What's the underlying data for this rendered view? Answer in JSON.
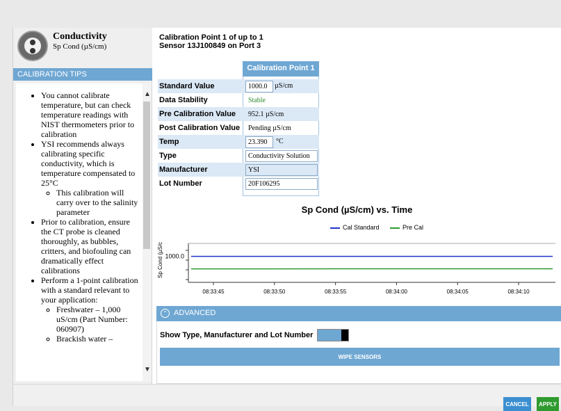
{
  "sensor": {
    "name": "Conductivity",
    "subtitle": "Sp Cond (µS/cm)",
    "icon": "conductivity-sensor-icon"
  },
  "tips": {
    "header": "CALIBRATION TIPS",
    "items": [
      "You cannot calibrate temperature, but can check temperature readings with NIST thermometers prior to calibration",
      "YSI recommends always calibrating specific conductivity, which is temperature compensated to 25°C",
      "This calibration will carry over to the salinity parameter",
      "Prior to calibration, ensure the CT probe is cleaned thoroughly, as bubbles, critters, and biofouling can dramatically effect calibrations",
      "Perform a 1-point calibration with a standard relevant to your application:",
      "Freshwater – 1,000 uS/cm (Part Number: 060907)",
      "Brackish water –"
    ]
  },
  "calibration": {
    "title_line1": "Calibration Point  1  of up to  1",
    "title_line2": "Sensor 13J100849 on Port 3",
    "point_header": "Calibration Point 1",
    "rows": [
      {
        "label": "Standard Value",
        "value": "1000.0",
        "unit": "µS/cm"
      },
      {
        "label": "Data Stability",
        "value": "Stable",
        "unit": ""
      },
      {
        "label": "Pre Calibration Value",
        "value": "952.1 µS/cm",
        "unit": ""
      },
      {
        "label": "Post Calibration Value",
        "value": "Pending µS/cm",
        "unit": ""
      },
      {
        "label": "Temp",
        "value": "23.390",
        "unit": "°C"
      },
      {
        "label": "Type",
        "value": "Conductivity Solution",
        "unit": ""
      },
      {
        "label": "Manufacturer",
        "value": "YSI",
        "unit": ""
      },
      {
        "label": "Lot Number",
        "value": "20F106295",
        "unit": ""
      }
    ]
  },
  "chart_data": {
    "type": "line",
    "title": "Sp Cond (µS/cm) vs. Time",
    "ylabel": "Sp Cond (µS/c",
    "xlabel": "",
    "x": [
      "08:33:45",
      "08:33:50",
      "08:33:55",
      "08:34:00",
      "08:34:05",
      "08:34:10"
    ],
    "y_tick_labels": [
      "1000.0"
    ],
    "ylim": [
      900,
      1050
    ],
    "series": [
      {
        "name": "Cal Standard",
        "color": "#2233cc",
        "values": [
          1000.0,
          1000.0,
          1000.0,
          1000.0,
          1000.0,
          1000.0
        ]
      },
      {
        "name": "Pre Cal",
        "color": "#2d9a2d",
        "values": [
          952.0,
          952.0,
          952.1,
          952.1,
          952.2,
          952.3
        ]
      }
    ],
    "grid": false,
    "legend_position": "top"
  },
  "advanced": {
    "label": "ADVANCED",
    "toggle_label": "Show Type, Manufacturer and Lot Number",
    "toggle_on": true,
    "wipe_button": "WIPE SENSORS"
  },
  "footer": {
    "cancel": "CANCEL",
    "apply": "APPLY"
  },
  "colors": {
    "accent": "#6fa7d3",
    "apply": "#2f9a2f",
    "cancel": "#3b8fd1"
  }
}
